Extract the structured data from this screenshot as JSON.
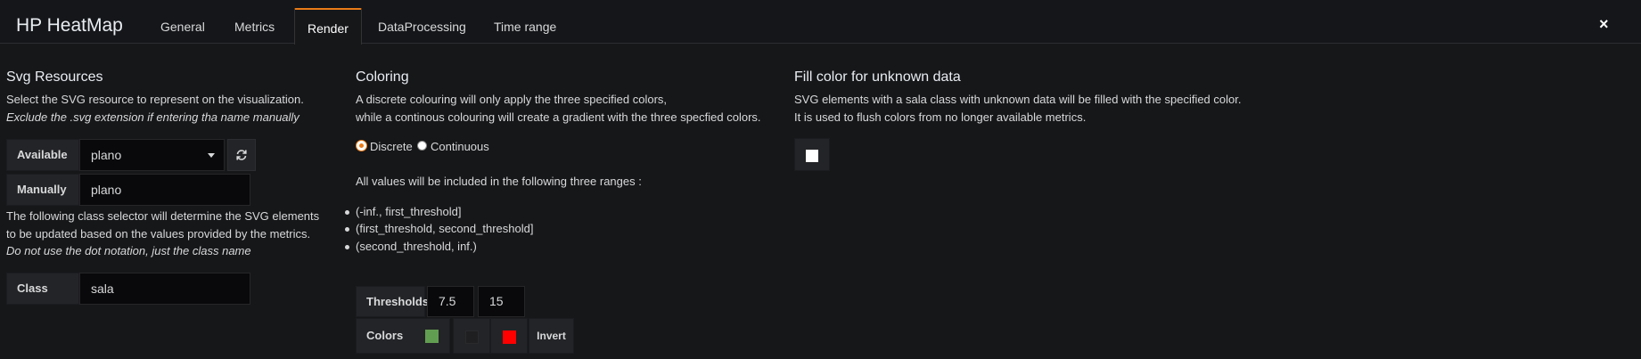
{
  "header": {
    "title": "HP HeatMap",
    "tabs": [
      "General",
      "Metrics",
      "Render",
      "DataProcessing",
      "Time range"
    ],
    "active_tab": "Render",
    "close_icon": "×"
  },
  "svg_resources": {
    "heading": "Svg Resources",
    "desc_line1": "Select the SVG resource to represent on the visualization.",
    "desc_line2": "Exclude the .svg extension if entering tha name manually",
    "available_label": "Available",
    "available_value": "plano",
    "manually_label": "Manually",
    "manually_value": "plano",
    "class_desc_line1": "The following class selector will determine the SVG elements",
    "class_desc_line2": "to be updated based on the values provided by the metrics.",
    "class_desc_line3": "Do not use the dot notation, just the class name",
    "class_label": "Class",
    "class_value": "sala"
  },
  "coloring": {
    "heading": "Coloring",
    "desc_line1": "A discrete colouring will only apply the three specified colors,",
    "desc_line2": "while a continous colouring will create a gradient with the three specfied colors.",
    "mode_discrete": "Discrete",
    "mode_continuous": "Continuous",
    "selected_mode": "Discrete",
    "ranges_intro": "All values will be included in the following three ranges :",
    "ranges": [
      "(-inf., first_threshold]",
      "(first_threshold, second_threshold]",
      "(second_threshold, inf.)"
    ],
    "thresholds_label": "Thresholds",
    "threshold_1": "7.5",
    "threshold_2": "15",
    "colors_label": "Colors",
    "colors": [
      "#629e51",
      "#1f1f22",
      "#ff0000"
    ],
    "invert_label": "Invert"
  },
  "unknown": {
    "heading": "Fill color for unknown data",
    "desc_line1": "SVG elements with a sala class with unknown data will be filled with the specified color.",
    "desc_line2": "It is used to flush colors from no longer available metrics.",
    "color": "#ffffff"
  }
}
